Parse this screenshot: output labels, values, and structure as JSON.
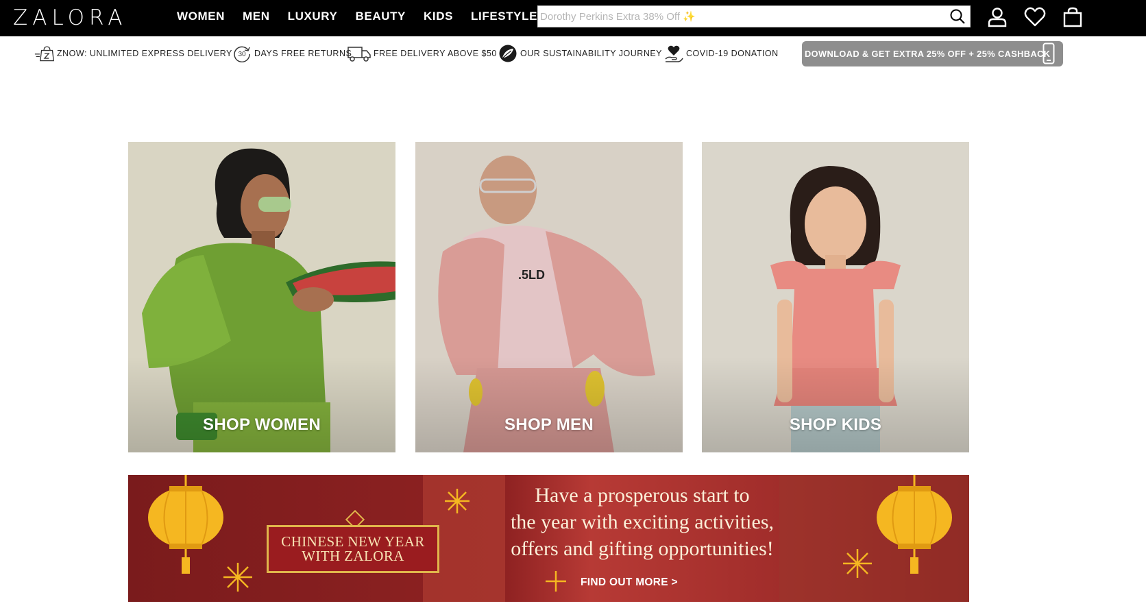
{
  "header": {
    "logo": "ZALORA",
    "nav": [
      "WOMEN",
      "MEN",
      "LUXURY",
      "BEAUTY",
      "KIDS",
      "LIFESTYLE"
    ],
    "search_placeholder": "Dorothy Perkins Extra 38% Off ✨",
    "icons": [
      "search-icon",
      "account-icon",
      "wishlist-heart-icon",
      "bag-icon"
    ]
  },
  "promo_strip": {
    "items": [
      {
        "label": "ZNOW: UNLIMITED EXPRESS DELIVERY",
        "icon": "express-bag-icon"
      },
      {
        "label": "DAYS FREE RETURNS",
        "icon": "30-days-icon",
        "badge": "30"
      },
      {
        "label": "FREE DELIVERY ABOVE $50",
        "icon": "truck-icon"
      },
      {
        "label": "OUR SUSTAINABILITY JOURNEY",
        "icon": "leaf-globe-icon"
      },
      {
        "label": "COVID-19 DONATION",
        "icon": "heart-hand-icon"
      }
    ],
    "app_button": {
      "label": "DOWNLOAD & GET EXTRA 25% OFF + 25% CASHBACK",
      "icon": "phone-icon"
    }
  },
  "tiles": [
    {
      "label": "SHOP WOMEN"
    },
    {
      "label": "SHOP MEN"
    },
    {
      "label": "SHOP KIDS"
    }
  ],
  "banner": {
    "badge_line1": "CHINESE NEW YEAR",
    "badge_line2": "WITH ZALORA",
    "headline_line1": "Have a prosperous start to",
    "headline_line2": "the year with exciting activities,",
    "headline_line3": "offers and gifting opportunities!",
    "cta": "FIND OUT MORE >"
  },
  "colors": {
    "header_bg": "#000000",
    "app_button_bg": "#8e8e8e",
    "banner_red": "#8b1d1f",
    "lantern_gold": "#f5b721"
  }
}
